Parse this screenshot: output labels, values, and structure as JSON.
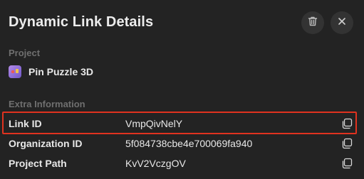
{
  "header": {
    "title": "Dynamic Link Details",
    "delete_icon": "trash-icon",
    "close_icon": "close-icon"
  },
  "project_section": {
    "label": "Project",
    "app_icon": "app-icon",
    "project_name": "Pin Puzzle 3D"
  },
  "extra_section": {
    "label": "Extra Information",
    "rows": [
      {
        "label": "Link ID",
        "value": "VmpQivNelY",
        "copy_icon": "copy-icon"
      },
      {
        "label": "Organization ID",
        "value": "5f084738cbe4e700069fa940",
        "copy_icon": "copy-icon"
      },
      {
        "label": "Project Path",
        "value": "KvV2VczgOV",
        "copy_icon": "copy-icon"
      }
    ]
  },
  "highlight": {
    "target": "Link ID",
    "color": "#e0321f"
  },
  "colors": {
    "background": "#232323",
    "section_label": "#6f6f6f",
    "text": "#e8e8e8",
    "button_bg": "#333333"
  }
}
